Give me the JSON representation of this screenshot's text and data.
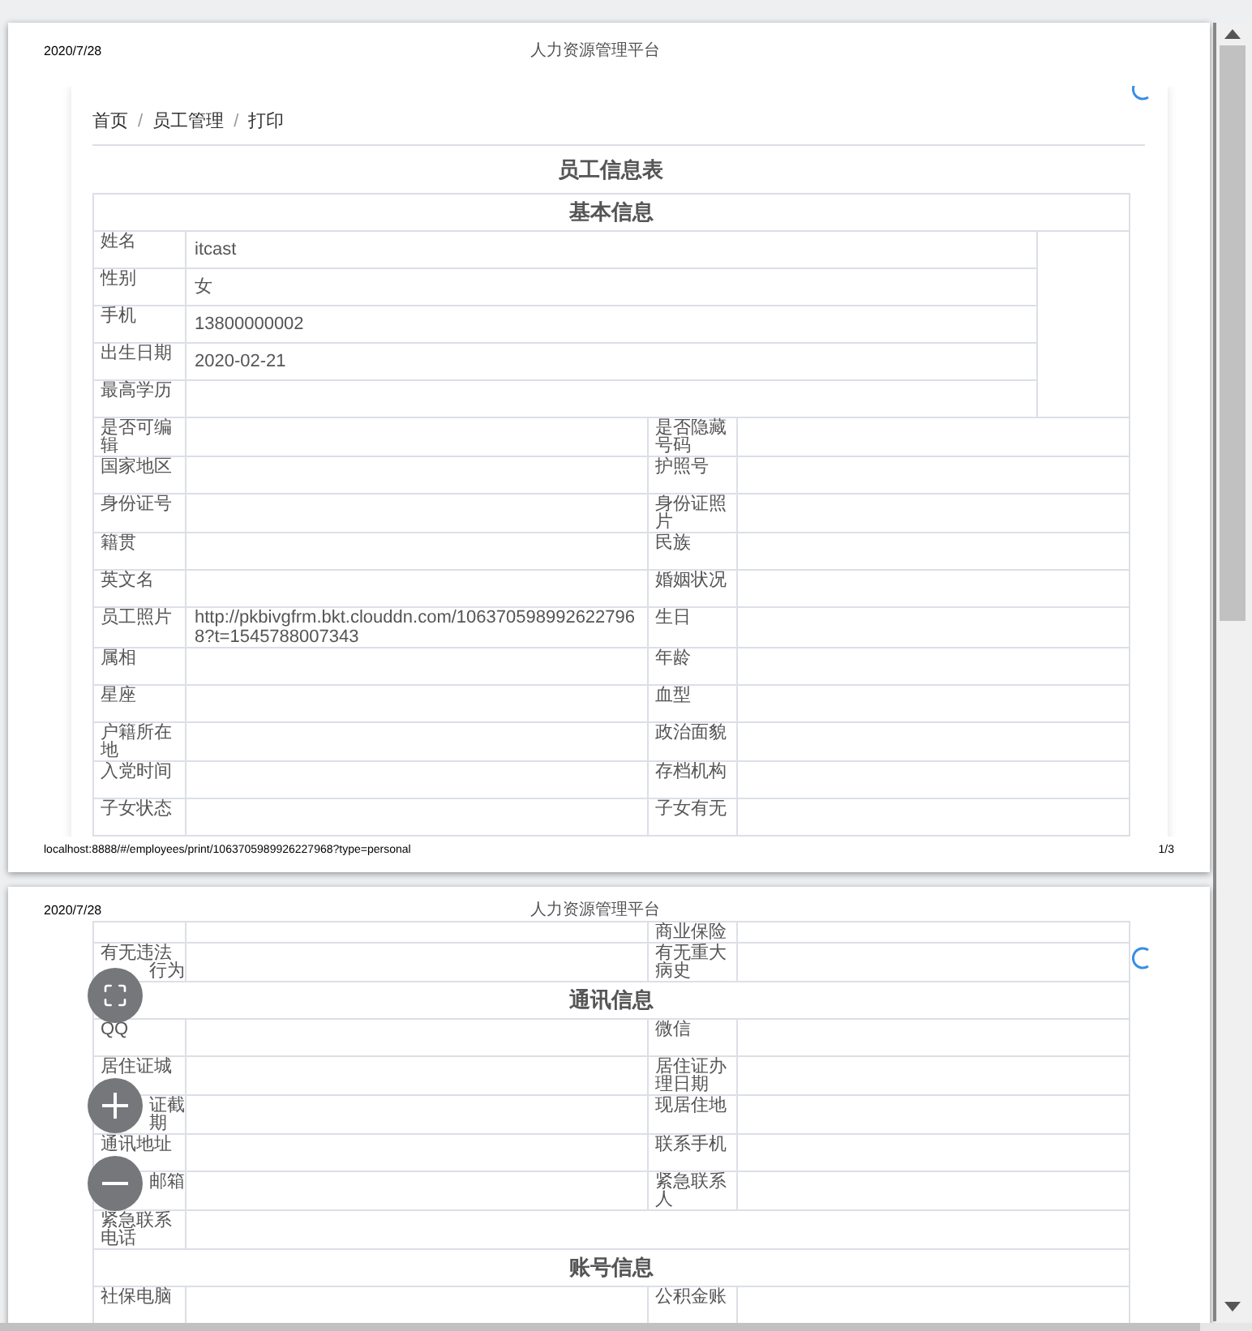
{
  "pages": [
    {
      "header": {
        "date": "2020/7/28",
        "title": "人力资源管理平台"
      },
      "breadcrumb": [
        {
          "label": "首页",
          "separator": "/"
        },
        {
          "label": "员工管理",
          "separator": "/"
        },
        {
          "label": "打印"
        }
      ],
      "heading": "员工信息表",
      "blocks": [
        {
          "kind": "section",
          "title": "基本信息"
        },
        {
          "kind": "top",
          "label": "姓名",
          "value": "itcast"
        },
        {
          "kind": "top",
          "label": "性别",
          "value": "女"
        },
        {
          "kind": "top",
          "label": "手机",
          "value": "13800000002"
        },
        {
          "kind": "top",
          "label": "出生日期",
          "value": "2020-02-21"
        },
        {
          "kind": "top",
          "label": "最高学历"
        },
        {
          "kind": "row",
          "label": "是否可编辑",
          "label_2": "是否隐藏号码"
        },
        {
          "kind": "row",
          "label": "国家地区",
          "label_2": "护照号"
        },
        {
          "kind": "row",
          "label": "身份证号",
          "label_2": "身份证照片"
        },
        {
          "kind": "row",
          "label": "籍贯",
          "label_2": "民族"
        },
        {
          "kind": "row",
          "label": "英文名",
          "label_2": "婚姻状况"
        },
        {
          "kind": "row",
          "label": "员工照片",
          "value": "http://pkbivgfrm.bkt.clouddn.com/1063705989926227968?t=1545788007343",
          "label_2": "生日"
        },
        {
          "kind": "row",
          "label": "属相",
          "label_2": "年龄"
        },
        {
          "kind": "row",
          "label": "星座",
          "label_2": "血型"
        },
        {
          "kind": "row",
          "label": "户籍所在地",
          "label_2": "政治面貌"
        },
        {
          "kind": "row",
          "label": "入党时间",
          "label_2": "存档机构"
        },
        {
          "kind": "row",
          "label": "子女状态",
          "label_2": "子女有无"
        }
      ],
      "footer": {
        "url": "localhost:8888/#/employees/print/1063705989926227968?type=personal",
        "page_number": "1/3"
      }
    },
    {
      "header": {
        "date": "2020/7/28",
        "title": "人力资源管理平台"
      },
      "blocks": [
        {
          "kind": "cut",
          "label_2": "商业保险"
        },
        {
          "kind": "row",
          "label_lines": [
            {
              "text": "有无违法",
              "covered": false
            },
            {
              "text": "行为",
              "covered": true
            }
          ],
          "label_2": "有无重大病史"
        },
        {
          "kind": "section",
          "title": "通讯信息"
        },
        {
          "kind": "row",
          "label": "QQ",
          "label_2": "微信"
        },
        {
          "kind": "row",
          "label_lines": [
            {
              "text": "居住证城",
              "covered": false
            }
          ],
          "label_2": "居住证办理日期"
        },
        {
          "kind": "row",
          "label_lines": [
            {
              "text": "证截",
              "covered": true
            },
            {
              "text": "期",
              "covered": true
            }
          ],
          "label_2": "现居住地"
        },
        {
          "kind": "row",
          "label": "通讯地址",
          "label_2": "联系手机"
        },
        {
          "kind": "row",
          "label_lines": [
            {
              "text": "邮箱",
              "covered": true
            }
          ],
          "label_2": "紧急联系人"
        },
        {
          "kind": "wide_row",
          "label": "紧急联系电话"
        },
        {
          "kind": "section",
          "title": "账号信息"
        },
        {
          "kind": "row",
          "label": "社保电脑",
          "label_2": "公积金账"
        }
      ]
    }
  ]
}
